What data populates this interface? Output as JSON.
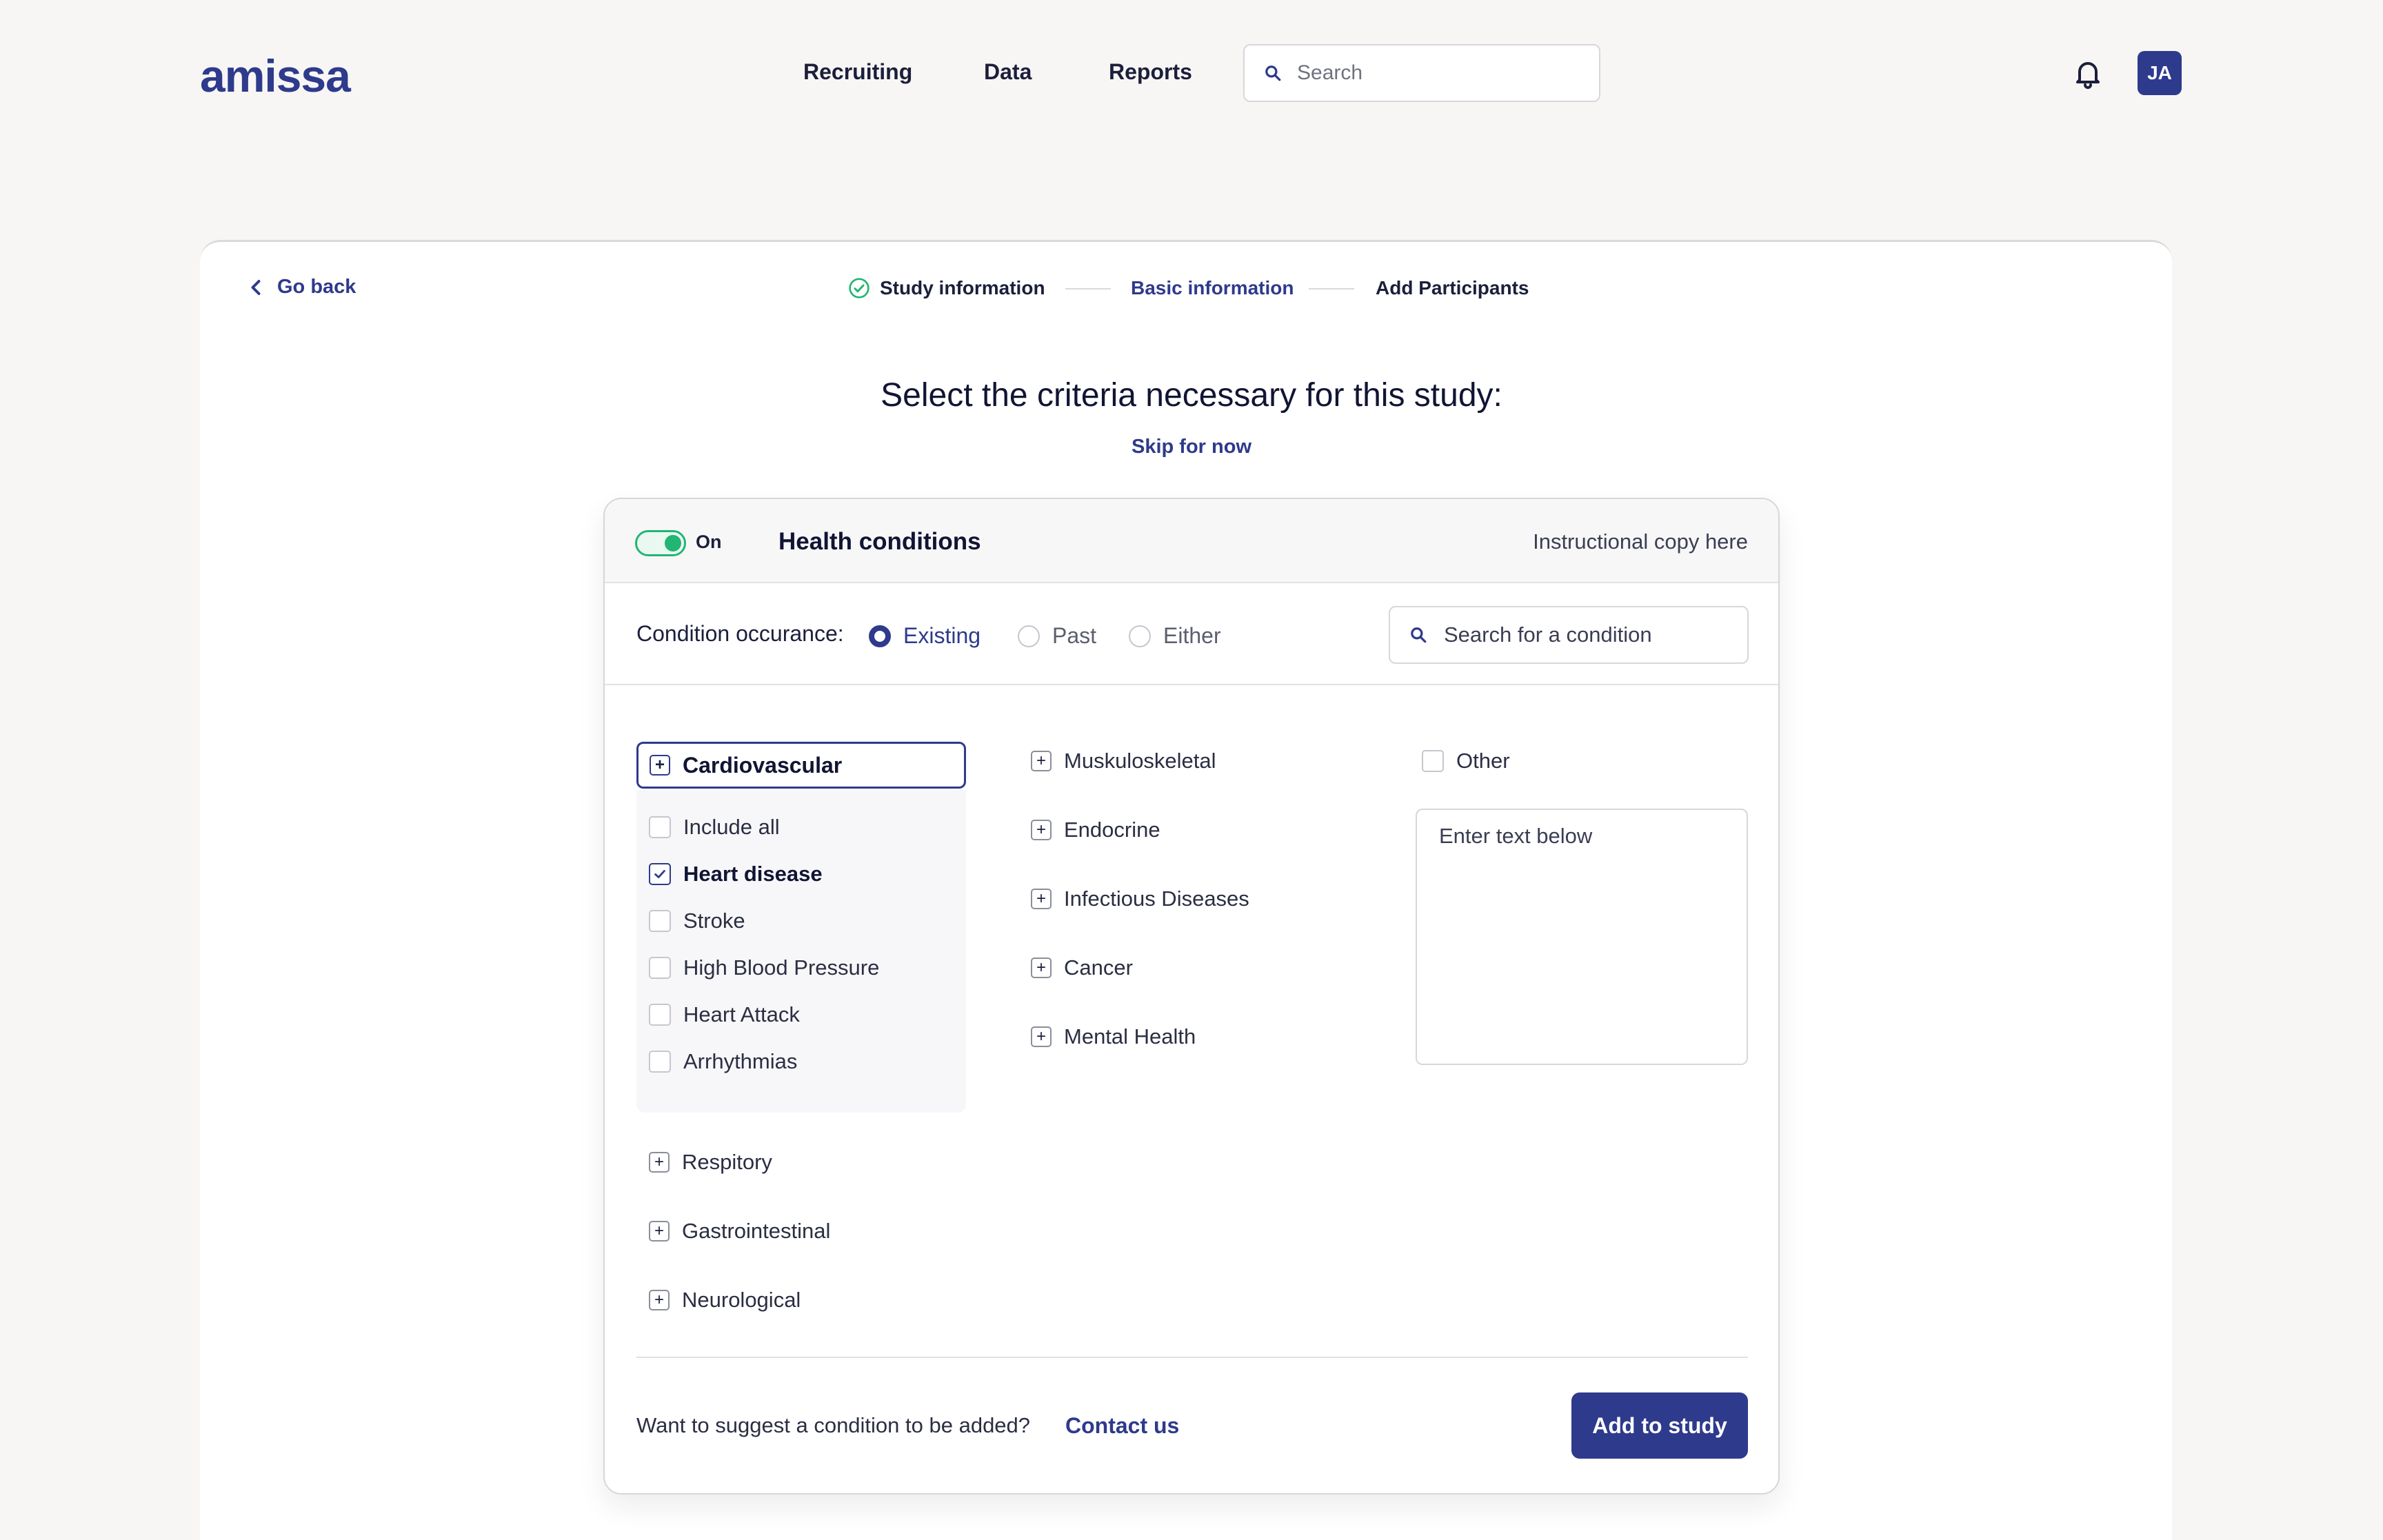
{
  "brand": {
    "logo": "amissa"
  },
  "nav": {
    "items": [
      "Recruiting",
      "Data",
      "Reports"
    ]
  },
  "search": {
    "placeholder": "Search"
  },
  "user": {
    "initials": "JA"
  },
  "back": {
    "label": "Go back"
  },
  "steps": [
    {
      "label": "Study information",
      "state": "done"
    },
    {
      "label": "Basic information",
      "state": "active"
    },
    {
      "label": "Add Participants",
      "state": "upcoming"
    }
  ],
  "page": {
    "title": "Select the criteria necessary for this study:",
    "skip": "Skip for now"
  },
  "panel": {
    "toggle_label": "On",
    "title": "Health conditions",
    "instruction": "Instructional copy here",
    "occurrence_label": "Condition occurance:",
    "occurrence_options": [
      "Existing",
      "Past",
      "Either"
    ],
    "occurrence_selected": "Existing",
    "condition_search_placeholder": "Search for a condition"
  },
  "categories": {
    "open": {
      "label": "Cardiovascular",
      "items": [
        {
          "label": "Include all",
          "checked": false
        },
        {
          "label": "Heart disease",
          "checked": true
        },
        {
          "label": "Stroke",
          "checked": false
        },
        {
          "label": "High Blood Pressure",
          "checked": false
        },
        {
          "label": "Heart Attack",
          "checked": false
        },
        {
          "label": "Arrhythmias",
          "checked": false
        }
      ]
    },
    "left": [
      "Respitory",
      "Gastrointestinal",
      "Neurological"
    ],
    "middle": [
      "Muskuloskeletal",
      "Endocrine",
      "Infectious Diseases",
      "Cancer",
      "Mental Health"
    ],
    "other_label": "Other",
    "other_placeholder": "Enter text below"
  },
  "footer": {
    "suggest": "Want to suggest a condition to be added?",
    "contact": "Contact us",
    "add_button": "Add to study"
  },
  "colors": {
    "primary": "#2e3a8c",
    "toggle_on": "#22b573",
    "background": "#f7f6f4"
  }
}
